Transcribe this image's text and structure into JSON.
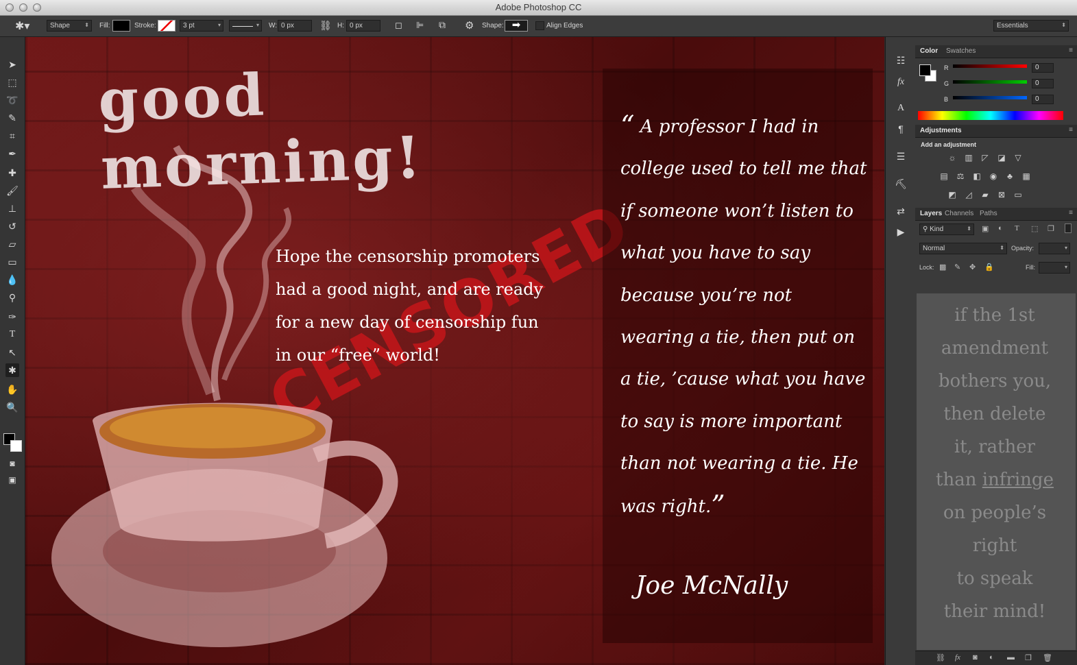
{
  "window": {
    "title": "Adobe Photoshop CC"
  },
  "options_bar": {
    "mode": "Shape",
    "fill_label": "Fill:",
    "stroke_label": "Stroke:",
    "stroke_size": "3 pt",
    "w_label": "W:",
    "w_value": "0 px",
    "h_label": "H:",
    "h_value": "0 px",
    "shape_label": "Shape:",
    "align_edges": "Align Edges",
    "workspace": "Essentials"
  },
  "canvas": {
    "headline": "good morning!",
    "censored_stamp": "CENSORED",
    "message_lines": [
      "Hope the censorship promoters",
      "had a good night, and are ready",
      "for a new day of censorship fun",
      "in our “free” world!"
    ],
    "quote_open": "“",
    "quote_text": "A professor I had in college used to tell me that if someone won’t listen to what you have to say because you’re not wearing a tie, then put on a tie, ’cause what you have to say is more important than not wearing a tie. He was right.",
    "quote_close": "”",
    "signature": "Joe McNally"
  },
  "color_panel": {
    "tab_color": "Color",
    "tab_swatches": "Swatches",
    "r_label": "R",
    "r_value": "0",
    "g_label": "G",
    "g_value": "0",
    "b_label": "B",
    "b_value": "0"
  },
  "adjustments_panel": {
    "tab": "Adjustments",
    "subtitle": "Add an adjustment"
  },
  "layers_panel": {
    "tab_layers": "Layers",
    "tab_channels": "Channels",
    "tab_paths": "Paths",
    "kind_label": "Kind",
    "blend_mode": "Normal",
    "opacity_label": "Opacity:",
    "lock_label": "Lock:",
    "fill_label": "Fill:",
    "text_lines_before": [
      "if the 1st",
      "amendment",
      "bothers you,",
      "then delete",
      "it, rather"
    ],
    "text_than": "than ",
    "text_infringe": "infringe",
    "text_lines_after": [
      "on people’s",
      "right",
      "to speak",
      "their mind!"
    ]
  },
  "colors": {
    "accent_red": "#d0151a",
    "panel_bg": "#3a3a3a",
    "canvas_red": "#5c1212"
  }
}
